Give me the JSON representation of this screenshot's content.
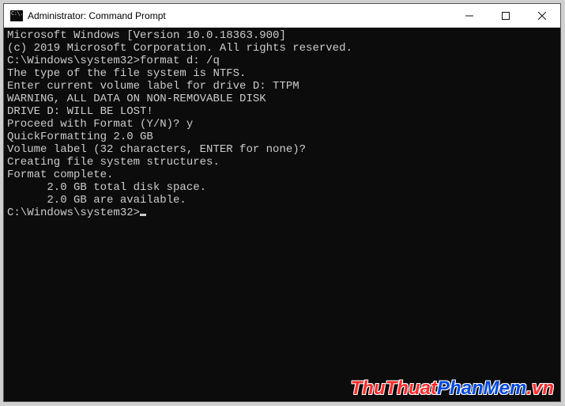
{
  "titlebar": {
    "icon_glyph": "C:\\.",
    "title": "Administrator: Command Prompt"
  },
  "terminal": {
    "lines": [
      "Microsoft Windows [Version 10.0.18363.900]",
      "(c) 2019 Microsoft Corporation. All rights reserved.",
      "",
      "C:\\Windows\\system32>format d: /q",
      "The type of the file system is NTFS.",
      "Enter current volume label for drive D: TTPM",
      "",
      "WARNING, ALL DATA ON NON-REMOVABLE DISK",
      "DRIVE D: WILL BE LOST!",
      "Proceed with Format (Y/N)? y",
      "QuickFormatting 2.0 GB",
      "Volume label (32 characters, ENTER for none)?",
      "Creating file system structures.",
      "Format complete.",
      "      2.0 GB total disk space.",
      "      2.0 GB are available.",
      ""
    ],
    "prompt": "C:\\Windows\\system32>"
  },
  "watermark": {
    "part1": "ThuThuat",
    "part2": "PhanMem",
    "part3": ".vn"
  }
}
